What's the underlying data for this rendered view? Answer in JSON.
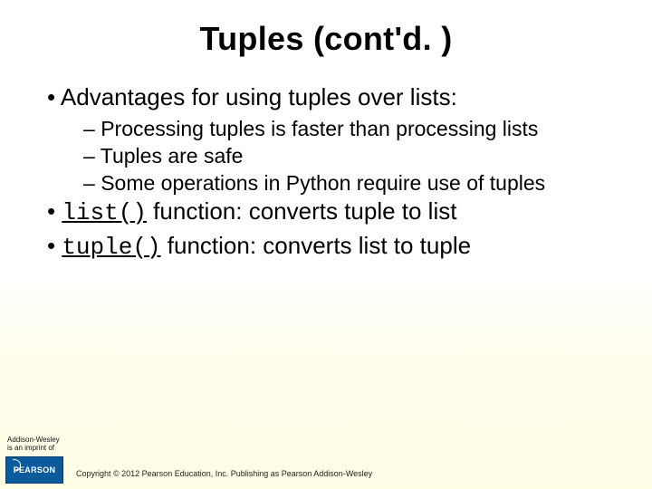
{
  "title": "Tuples (cont'd. )",
  "bullets": {
    "b1": "Advantages for using tuples over lists:",
    "b1_subs": {
      "s1": "Processing tuples is faster than processing lists",
      "s2": "Tuples are safe",
      "s3": "Some operations in Python require use of tuples"
    },
    "b2_code": "list()",
    "b2_rest": " function: converts tuple to list",
    "b3_code": "tuple()",
    "b3_rest": " function: converts list to tuple"
  },
  "footer": {
    "imprint_line1": "Addison-Wesley",
    "imprint_line2": "is an imprint of",
    "pearson": "PEARSON",
    "copyright": "Copyright © 2012 Pearson Education, Inc. Publishing as Pearson Addison-Wesley"
  }
}
